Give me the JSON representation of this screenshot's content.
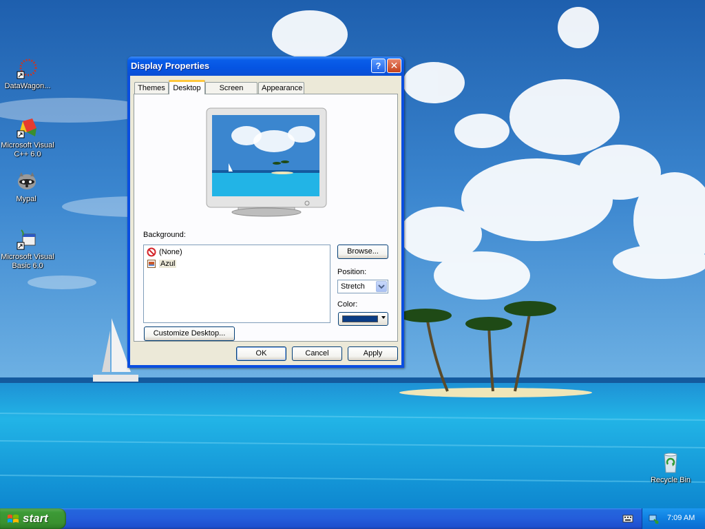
{
  "desktop": {
    "icons": [
      {
        "label": "DataWagon..."
      },
      {
        "label": "Microsoft Visual C++ 6.0"
      },
      {
        "label": "Mypal"
      },
      {
        "label": "Microsoft Visual Basic 6.0"
      },
      {
        "label": "Recycle Bin"
      }
    ]
  },
  "dialog": {
    "title": "Display Properties",
    "help_label": "?",
    "close_label": "✕",
    "tabs": [
      {
        "label": "Themes"
      },
      {
        "label": "Desktop"
      },
      {
        "label": "Screen Saver"
      },
      {
        "label": "Appearance"
      }
    ],
    "active_tab": "Desktop",
    "background_label": "Background:",
    "background_items": [
      {
        "label": "(None)",
        "icon": "no-icon"
      },
      {
        "label": "Azul",
        "icon": "image-file-icon"
      }
    ],
    "browse_label": "Browse...",
    "position_label": "Position:",
    "position_value": "Stretch",
    "color_label": "Color:",
    "color_value": "#0b3c84",
    "customize_label": "Customize Desktop...",
    "ok_label": "OK",
    "cancel_label": "Cancel",
    "apply_label": "Apply"
  },
  "taskbar": {
    "start_label": "start",
    "clock": "7:09 AM"
  },
  "colors": {
    "title_blue": "#0554e2",
    "dialog_face": "#ece9d8",
    "start_green": "#3a9130",
    "taskbar_blue": "#245ddb"
  }
}
